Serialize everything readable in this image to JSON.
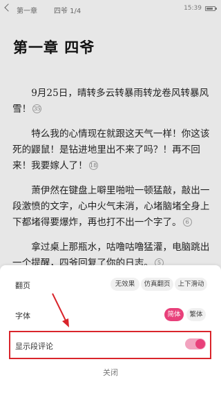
{
  "status_bar": {
    "chapter": "第一章",
    "page": "四爷 1/4",
    "time": "15:39"
  },
  "chapter_title": "第一章 四爷",
  "paragraphs": [
    {
      "text": "9月25日，晴转多云转暴雨转龙卷风转暴风雪！",
      "comments": "35"
    },
    {
      "text": "特么我的心情现在就跟这天气一样！你这该死的鼹鼠！是钻进地里出不来了吗？！再不回来！我要嫁人了！",
      "comments": "18"
    },
    {
      "text": "萧伊然在键盘上噼里啪啦一顿猛敲，敲出一段激愤的文字，心中火气未消，心堵脑堵全身上下都堵得要爆炸，再也打不出一个字了。",
      "comments": "6"
    },
    {
      "text": "拿过桌上那瓶水，咕噜咕噜猛灌，电脑跳出一个提醒，四爷回复了你的日志。",
      "comments": "5"
    }
  ],
  "settings_panel": {
    "page_turn": {
      "label": "翻页",
      "options": [
        "无效果",
        "仿真翻页",
        "上下滑动"
      ]
    },
    "font": {
      "label": "字体",
      "options": [
        "简体",
        "繁体"
      ],
      "selected": "简体"
    },
    "show_comments": {
      "label": "显示段评论",
      "enabled": true
    },
    "close_label": "关闭"
  },
  "colors": {
    "accent": "#e8407a",
    "annotation": "#d9242b"
  }
}
